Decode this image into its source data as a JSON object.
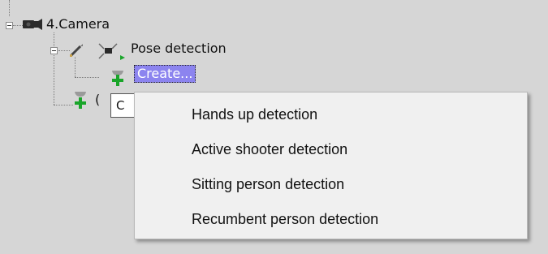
{
  "tree": {
    "camera_label": "4.Camera",
    "pose_label": "Pose detection",
    "create_label": "Create...",
    "tooltip_text": "C"
  },
  "context_menu": {
    "items": [
      "Hands up detection",
      "Active shooter detection",
      "Sitting person detection",
      "Recumbent person detection"
    ]
  },
  "colors": {
    "background": "#d6d6d6",
    "selection": "#8c84ef",
    "plus_icon": "#1aa52a",
    "menu_background": "#f0f0f0"
  },
  "icons": [
    "expander-minus-icon",
    "camera-icon",
    "pencil-icon",
    "pose-detection-icon",
    "create-plus-icon"
  ]
}
